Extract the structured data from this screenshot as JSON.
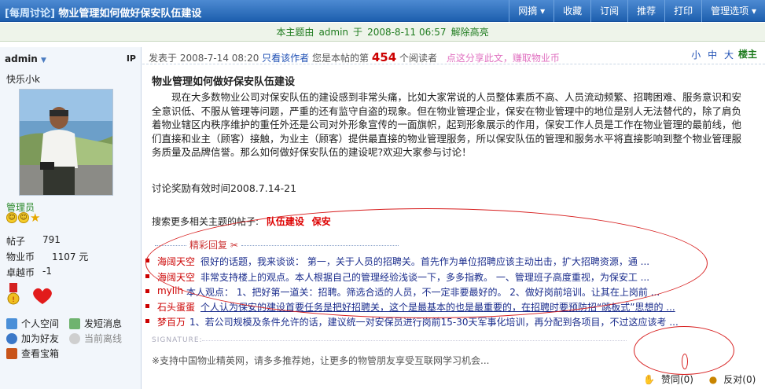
{
  "thread": {
    "tag": "[每周讨论]",
    "title": "物业管理如何做好保安队伍建设"
  },
  "top_menu": [
    "网摘 ▾",
    "收藏",
    "订阅",
    "推荐",
    "打印",
    "管理选项 ▾"
  ],
  "notice": {
    "prefix": "本主题由",
    "user": "admin",
    "label": "于",
    "date": "2008-8-11 06:57",
    "action": "解除高亮"
  },
  "author": {
    "name": "admin",
    "ip_label": "IP",
    "nickname": "快乐小k",
    "role": "管理员",
    "stats": [
      {
        "label": "帖子",
        "value": "791"
      },
      {
        "label": "物业币",
        "value": "1107 元"
      },
      {
        "label": "卓越币",
        "value": "-1"
      }
    ],
    "links": [
      "个人空间",
      "发短消息",
      "加为好友",
      "当前离线",
      "查看宝箱"
    ]
  },
  "post_bar": {
    "posted_label": "发表于",
    "posted_at": "2008-7-14 08:20",
    "author_only": "只看该作者",
    "reader_prefix": "您是本帖的第",
    "reader_count": "454",
    "reader_suffix": "个阅读者",
    "share": "点这分享此文，赚取物业币",
    "font_sizes": [
      "小",
      "中",
      "大"
    ],
    "floor": "楼主"
  },
  "post": {
    "title": "物业管理如何做好保安队伍建设",
    "body": "现在大多数物业公司对保安队伍的建设感到非常头痛，比如大家常说的人员整体素质不高、人员流动频繁、招聘困难、服务意识和安全意识低、不服从管理等问题，严重的还有监守自盗的现象。但在物业管理企业，保安在物业管理中的地位是别人无法替代的，除了肩负着物业辖区内秩序维护的重任外还是公司对外形象宣传的一面旗帜，起到形象展示的作用，保安工作人员是工作在物业管理的最前线，他们直接和业主（顾客）接触，为业主（顾客）提供最直接的物业管理服务，所以保安队伍的管理和服务水平将直接影响到整个物业管理服务质量及品牌信誉。那么如何做好保安队伍的建设呢?欢迎大家参与讨论！",
    "award": "讨论奖励有效时间2008.7.14-21",
    "search_label": "搜索更多相关主题的帖子:",
    "keywords": [
      "队伍建设",
      "保安"
    ]
  },
  "replies": {
    "heading": "精彩回复 ✂",
    "items": [
      {
        "author": "海阔天空",
        "text": "很好的话题，我来谈谈：        第一，关于人员的招聘关。首先作为单位招聘应该主动出击，扩大招聘资源，通 ..."
      },
      {
        "author": "海阔天空",
        "text": "非常支持楼上的观点。本人根据自己的管理经验浅谈一下，多多指教。        一、管理班子高度重视，为保安工 ..."
      },
      {
        "author": "mylih",
        "text": "本人观点： 1、把好第一道关：招聘。筛选合适的人员，不一定非要最好的。 2、做好岗前培训。让其在上岗前 ..."
      },
      {
        "author": "石头蛋蛋",
        "text": "个人认为保安的建设首要任务是把好招聘关，这个是最基本的也是最重要的，在招聘时要预防招“跳板式”思想的 ..."
      },
      {
        "author": "梦百万",
        "text": "1、若公司规模及条件允许的话，建议统一对安保员进行岗前15-30天军事化培训，再分配到各项目，不过这应该考 ..."
      }
    ]
  },
  "signature": {
    "label": "SIGNATURE:",
    "text": "※支持中国物业精英网，请多多推荐她，让更多的物管朋友享受互联网学习机会..."
  },
  "vote": {
    "agree": "赞同(0)",
    "oppose": "反对(0)"
  },
  "colors": {
    "topbar": "#1d5fae",
    "notice_green": "#1f7c1f",
    "reply_author": "#cc0000",
    "highlight_ring": "#d71e1e"
  }
}
